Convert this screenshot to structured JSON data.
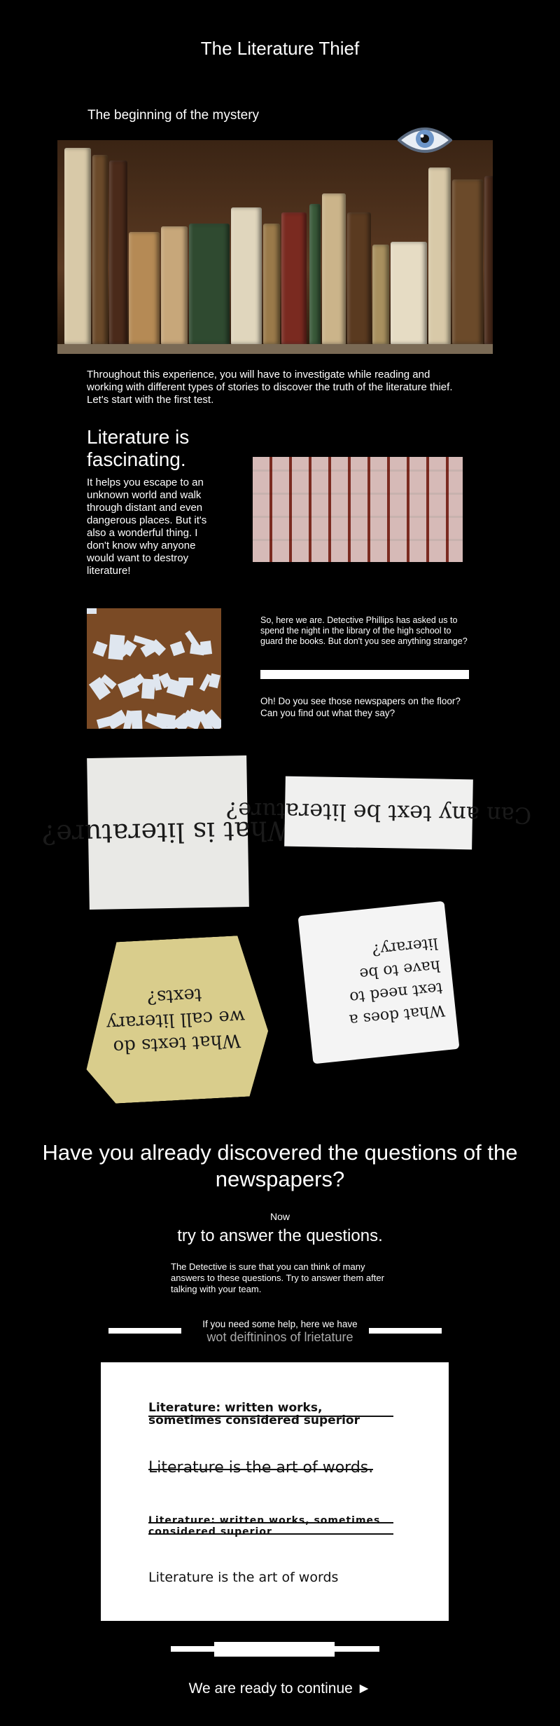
{
  "page": {
    "title": "The Literature Thief",
    "subtitle": "The beginning of the mystery",
    "intro": "Throughout this experience, you will have to investigate while reading and working with different types of stories to discover the truth of the literature thief. Let's start with the first test.",
    "heading": "Literature is fascinating.",
    "fascinating_text": "It helps you escape to an unknown world and walk through distant and even dangerous places. But it's also a wonderful thing. I don't know why anyone would want to destroy literature!",
    "detective_text": "So, here we are. Detective Phillips has asked us to spend the night in the library of the high school to guard the books. But don't you see anything strange?",
    "newspapers_text": "Oh! Do you see those newspapers on the floor? Can you find out what they say?",
    "clippings": [
      "What is literature?",
      "Can any text be literature?",
      "What texts do we call literary texts?",
      "What does a text need to have to be literary?"
    ],
    "discover_heading": "Have you already discovered the questions of the newspapers?",
    "now": "Now",
    "try_answer": "try to answer the questions.",
    "detective_hint": "The Detective is sure that you can think of many answers to these questions. Try to answer them after talking with your team.",
    "help_text": "If you need some help, here we have",
    "definitions_scrambled": "wot deiftininos of lrietature",
    "card_lines": [
      "Literature: written works, sometimes considered superior",
      "Literature is the art of words.",
      "Literature: written works, sometimes considered superior",
      "Literature is the art of words"
    ],
    "continue": "We are ready to continue ►"
  },
  "icons": [
    "eye-icon"
  ],
  "colors": {
    "background": "#000000",
    "text": "#ffffff",
    "muted": "#aaaaaa"
  }
}
